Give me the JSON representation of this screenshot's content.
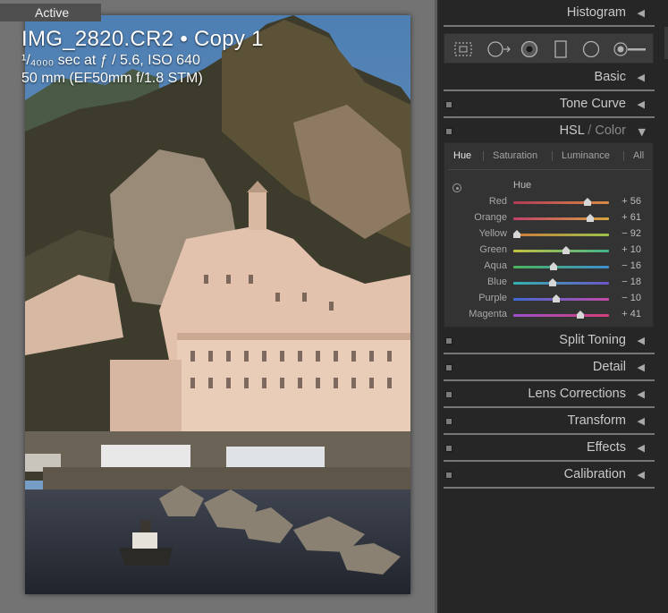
{
  "viewer": {
    "active_label": "Active",
    "filename": "IMG_2820.CR2 • Copy 1",
    "exposure": "¹/₄₀₀₀ sec at ƒ / 5.6, ISO 640",
    "lens": "50 mm (EF50mm f/1.8 STM)"
  },
  "panels": {
    "histogram": "Histogram",
    "basic": "Basic",
    "tone_curve": "Tone Curve",
    "hsl_main": "HSL",
    "hsl_slash": " / ",
    "hsl_color": "Color",
    "split_toning": "Split Toning",
    "detail": "Detail",
    "lens_corrections": "Lens Corrections",
    "transform": "Transform",
    "effects": "Effects",
    "calibration": "Calibration"
  },
  "tools": [
    "crop-overlay-icon",
    "spot-removal-icon",
    "red-eye-icon",
    "graduated-filter-icon",
    "radial-filter-icon",
    "adjustment-brush-icon"
  ],
  "hsl": {
    "tabs": [
      "Hue",
      "Saturation",
      "Luminance",
      "All"
    ],
    "active_tab": "Hue",
    "section": "Hue",
    "sliders": [
      {
        "name": "Red",
        "value": 56,
        "display": "+ 56",
        "colors": [
          "#b03a55",
          "#d88a45"
        ]
      },
      {
        "name": "Orange",
        "value": 61,
        "display": "+ 61",
        "colors": [
          "#c2406c",
          "#d4a43f"
        ]
      },
      {
        "name": "Yellow",
        "value": -92,
        "display": "− 92",
        "colors": [
          "#d27a3a",
          "#9ac24a"
        ]
      },
      {
        "name": "Green",
        "value": 10,
        "display": "+ 10",
        "colors": [
          "#c6c040",
          "#3fb48a"
        ]
      },
      {
        "name": "Aqua",
        "value": -16,
        "display": "− 16",
        "colors": [
          "#4cb55a",
          "#3d8fd0"
        ]
      },
      {
        "name": "Blue",
        "value": -18,
        "display": "− 18",
        "colors": [
          "#33b3b0",
          "#6a54c9"
        ]
      },
      {
        "name": "Purple",
        "value": -10,
        "display": "− 10",
        "colors": [
          "#3f6ad4",
          "#c44aa8"
        ]
      },
      {
        "name": "Magenta",
        "value": 41,
        "display": "+ 41",
        "colors": [
          "#9c4fc8",
          "#d4407a"
        ]
      }
    ]
  },
  "colors": {
    "panel_bg": "#262626",
    "viewer_bg": "#737373",
    "header_text": "#c9c9c9"
  }
}
